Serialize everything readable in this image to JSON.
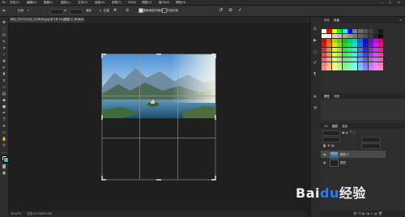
{
  "menubar": {
    "items": [
      "文件(F)",
      "编辑(E)",
      "图像(I)",
      "图层(L)",
      "文字(Y)",
      "选择(S)",
      "滤镜(T)",
      "3D(D)",
      "视图(V)",
      "窗口(W)",
      "帮助(H)"
    ]
  },
  "options": {
    "ratio_value": "比例",
    "clear_label": "清除",
    "straighten_label": "拉直",
    "delete_cropped_label": "删除裁剪的像素",
    "content_aware_label": "内容识别"
  },
  "document": {
    "tab_title": "IMG_20171124_114818.jpg @ 16.7%(图层 0, RGB/8)"
  },
  "status": {
    "zoom": "16.67%",
    "doc_info": "文档:29.3M/39.0M"
  },
  "panels": {
    "tabs_top": [
      "颜色",
      "色板"
    ],
    "tabs_mid": [
      "属性",
      "调整"
    ],
    "tabs_layers": [
      "3D",
      "图层",
      "通道"
    ]
  },
  "layers": [
    {
      "name": "图层 0",
      "selected": true
    },
    {
      "name": "图层",
      "selected": false
    }
  ],
  "watermark": {
    "brand": "Bai",
    "paw": "du",
    "suffix": "经验"
  }
}
